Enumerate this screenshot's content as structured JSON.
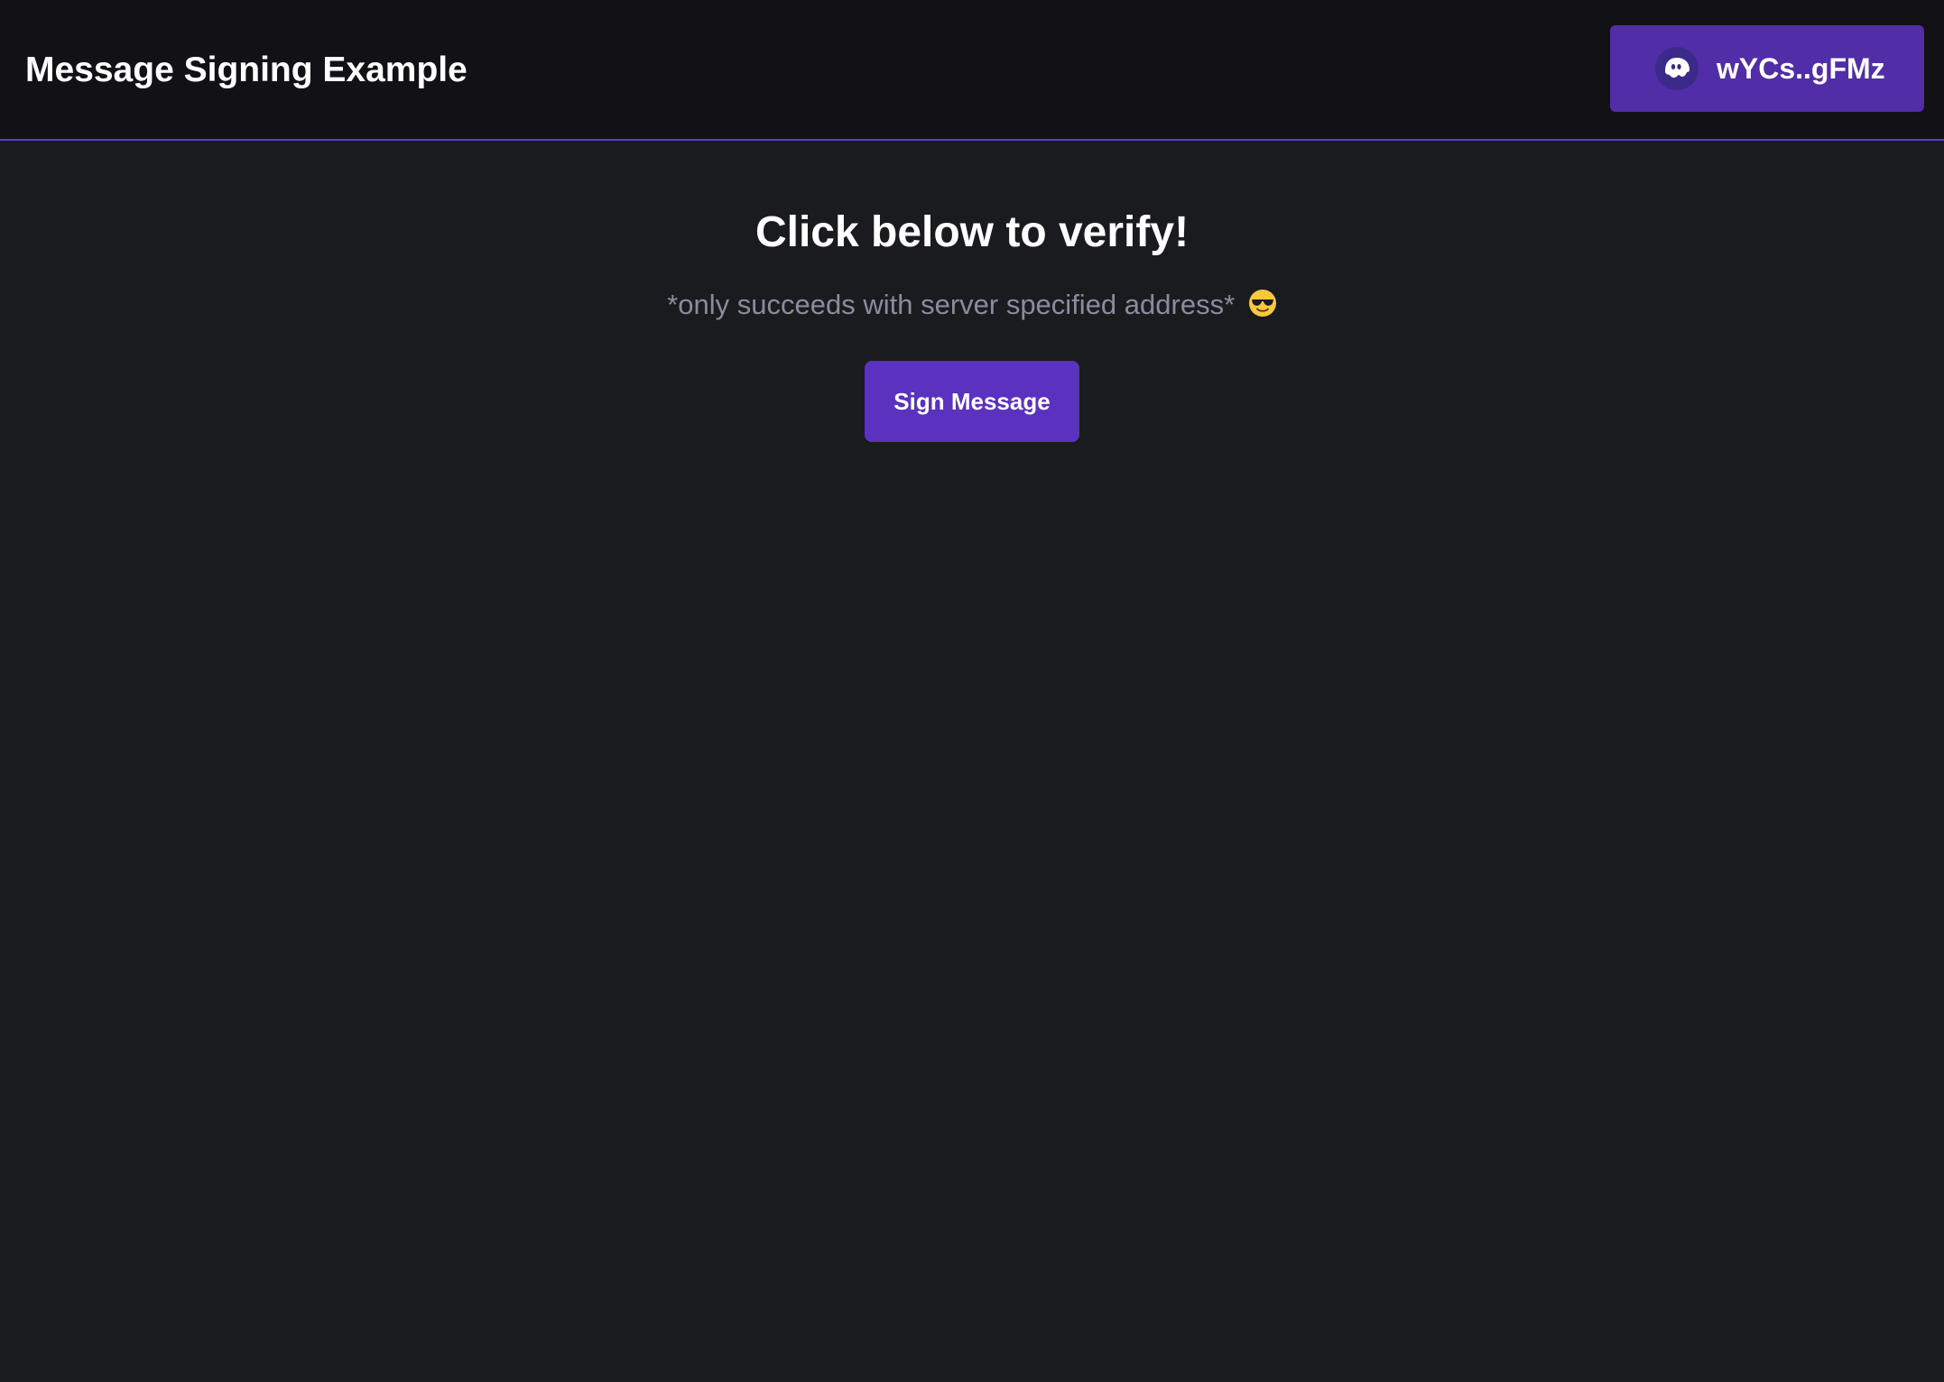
{
  "header": {
    "title": "Message Signing Example",
    "wallet": {
      "address": "wYCs..gFMz",
      "icon": "phantom-ghost-icon"
    }
  },
  "main": {
    "headline": "Click below to verify!",
    "subtext": "*only succeeds with server specified address*",
    "emoji": "smiling-face-with-sunglasses-emoji",
    "sign_button_label": "Sign Message"
  },
  "colors": {
    "background": "#1a1b1f",
    "header_background": "#111116",
    "header_border": "#5b3fc7",
    "wallet_button": "#512da8",
    "sign_button": "#5b32bf",
    "subtext": "#8a8c9e"
  }
}
